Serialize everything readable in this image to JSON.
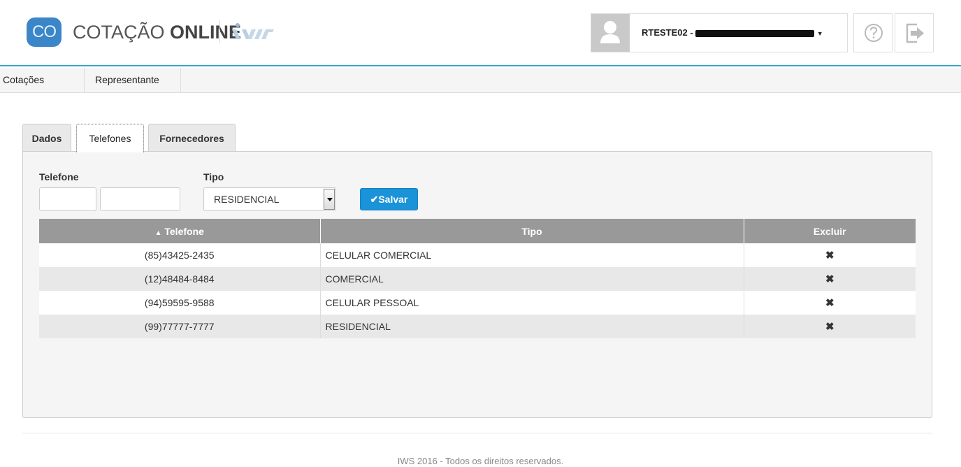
{
  "header": {
    "logo_badge": "CO",
    "logo_text_light": "COTAÇÃO ",
    "logo_text_bold": "ONLINE",
    "user_label": "RTESTE02 -"
  },
  "menu": {
    "items": [
      {
        "label": "Cotações"
      },
      {
        "label": "Representante"
      }
    ]
  },
  "tabs": [
    {
      "label": "Dados"
    },
    {
      "label": "Telefones"
    },
    {
      "label": "Fornecedores"
    }
  ],
  "form": {
    "telefone_label": "Telefone",
    "tipo_label": "Tipo",
    "ddd_value": "",
    "numero_value": "",
    "tipo_selected": "RESIDENCIAL",
    "save_label": "Salvar"
  },
  "table": {
    "columns": [
      "Telefone",
      "Tipo",
      "Excluir"
    ],
    "sort_indicator": "▲",
    "delete_glyph": "✖",
    "rows": [
      {
        "telefone": "(85)43425-2435",
        "tipo": "CELULAR COMERCIAL"
      },
      {
        "telefone": "(12)48484-8484",
        "tipo": "COMERCIAL"
      },
      {
        "telefone": "(94)59595-9588",
        "tipo": "CELULAR PESSOAL"
      },
      {
        "telefone": "(99)77777-7777",
        "tipo": "RESIDENCIAL"
      }
    ]
  },
  "footer": {
    "text": "IWS 2016 - Todos os direitos reservados."
  },
  "colors": {
    "accent": "#3ba6c9",
    "brand": "#3a86c9",
    "save_button": "#1a93d8",
    "table_header": "#999999"
  }
}
